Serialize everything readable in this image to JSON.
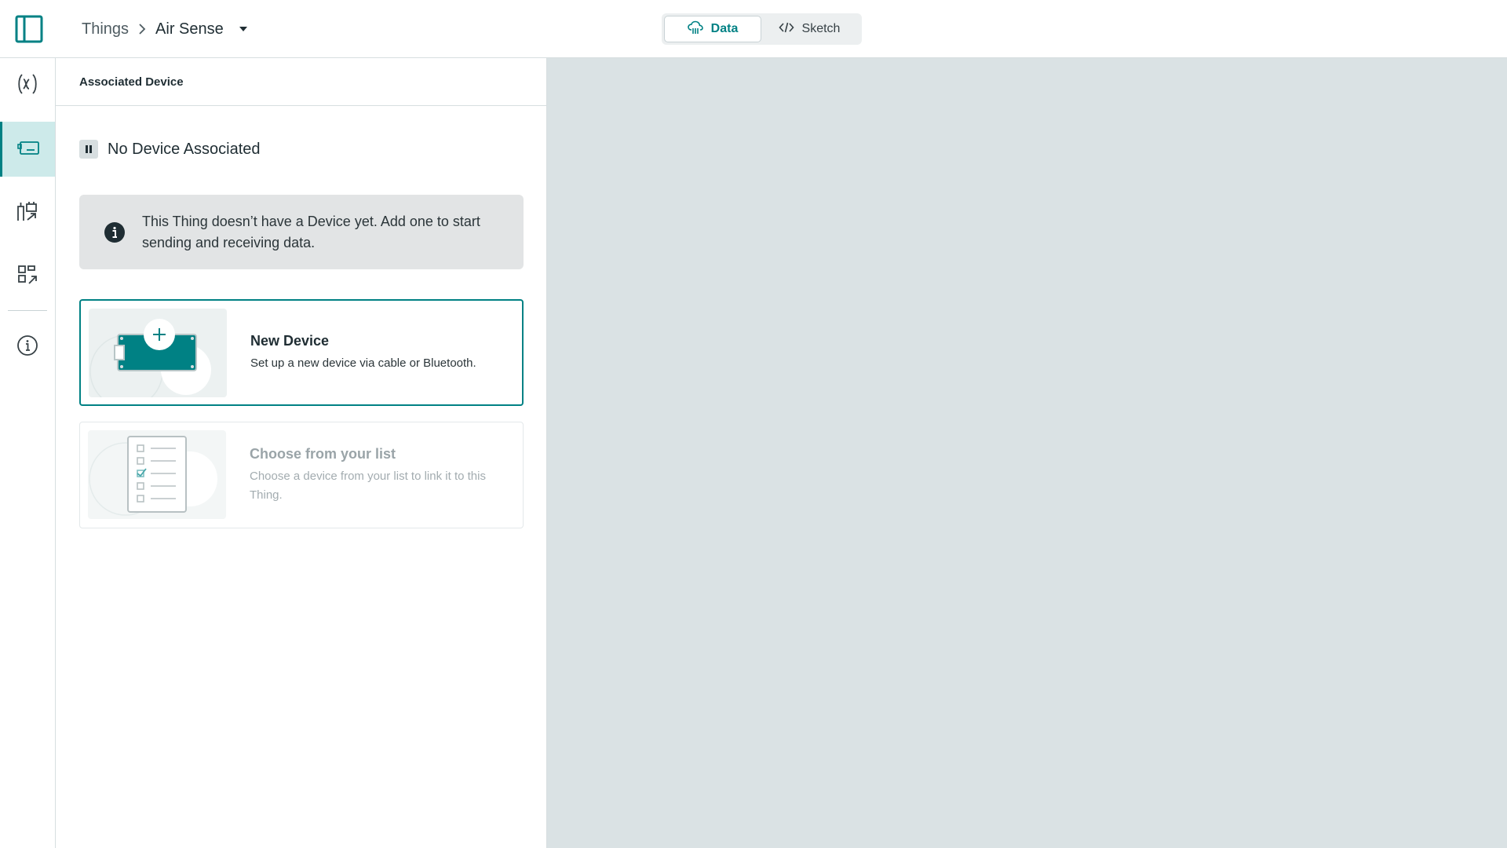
{
  "header": {
    "breadcrumb": {
      "root": "Things",
      "current": "Air Sense"
    },
    "view_switch": {
      "data_label": "Data",
      "sketch_label": "Sketch",
      "active": "Data"
    }
  },
  "rail": {
    "items": [
      {
        "icon": "variables-icon",
        "active": false
      },
      {
        "icon": "device-icon",
        "active": true
      },
      {
        "icon": "network-icon",
        "active": false
      },
      {
        "icon": "dashboard-link-icon",
        "active": false
      },
      {
        "icon": "info-icon",
        "active": false
      }
    ]
  },
  "panel": {
    "header_title": "Associated Device",
    "status_title": "No Device Associated",
    "info_text": "This Thing doesn’t have a Device yet. Add one to start sending and receiving data.",
    "options": [
      {
        "title": "New Device",
        "description": "Set up a new device via cable or Bluetooth.",
        "state": "selected"
      },
      {
        "title": "Choose from your list",
        "description": "Choose a device from your list to link it to this Thing.",
        "state": "disabled"
      }
    ]
  },
  "colors": {
    "accent": "#008184",
    "canvas_bg": "#dae2e4",
    "info_bg": "#e2e4e5",
    "rail_active_bg": "#cdeaea"
  }
}
